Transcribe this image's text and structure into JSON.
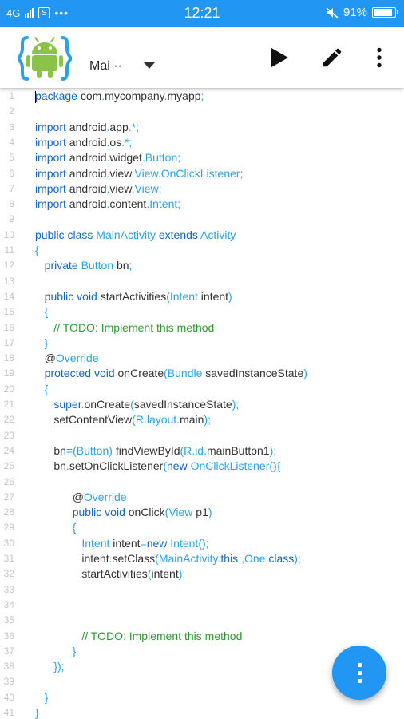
{
  "status_bar": {
    "network": "4G",
    "s_icon": "S",
    "dots": "•••",
    "time": "12:21",
    "battery": "91%",
    "battery_level": 0.91,
    "icons": [
      "signal-icon",
      "mute-icon",
      "battery-icon"
    ]
  },
  "toolbar": {
    "file_tab": "Mai ··",
    "actions": [
      "run-icon",
      "edit-icon",
      "more-vert-icon"
    ]
  },
  "colors": {
    "accent": "#2196f3",
    "keyword": "#1565c0",
    "type": "#29a3e6",
    "comment": "#2e9b2e",
    "text": "#333333",
    "gutter": "#c4c4c4"
  },
  "editor": {
    "lines": [
      {
        "num": "1",
        "text": "package com.mycompany.myapp;"
      },
      {
        "num": "2",
        "text": ""
      },
      {
        "num": "3",
        "text": "import android.app.*;"
      },
      {
        "num": "4",
        "text": "import android.os.*;"
      },
      {
        "num": "5",
        "text": "import android.widget.Button;"
      },
      {
        "num": "6",
        "text": "import android.view.View.OnClickListener;"
      },
      {
        "num": "7",
        "text": "import android.view.View;"
      },
      {
        "num": "8",
        "text": "import android.content.Intent;"
      },
      {
        "num": "9",
        "text": ""
      },
      {
        "num": "10",
        "text": "public class MainActivity extends Activity"
      },
      {
        "num": "11",
        "text": "{"
      },
      {
        "num": "12",
        "text": "   private Button bn;"
      },
      {
        "num": "13",
        "text": ""
      },
      {
        "num": "14",
        "text": "   public void startActivities(Intent intent)"
      },
      {
        "num": "15",
        "text": "   {"
      },
      {
        "num": "16",
        "text": "      // TODO: Implement this method"
      },
      {
        "num": "17",
        "text": "   }"
      },
      {
        "num": "18",
        "text": "   @Override"
      },
      {
        "num": "19",
        "text": "   protected void onCreate(Bundle savedInstanceState)"
      },
      {
        "num": "20",
        "text": "   {"
      },
      {
        "num": "21",
        "text": "      super.onCreate(savedInstanceState);"
      },
      {
        "num": "22",
        "text": "      setContentView(R.layout.main);"
      },
      {
        "num": "23",
        "text": ""
      },
      {
        "num": "24",
        "text": "      bn=(Button) findViewById(R.id.mainButton1);"
      },
      {
        "num": "25",
        "text": "      bn.setOnClickListener(new OnClickListener(){"
      },
      {
        "num": "26",
        "text": ""
      },
      {
        "num": "27",
        "text": "            @Override"
      },
      {
        "num": "28",
        "text": "            public void onClick(View p1)"
      },
      {
        "num": "29",
        "text": "            {"
      },
      {
        "num": "30",
        "text": "               Intent intent=new Intent();"
      },
      {
        "num": "31",
        "text": "               intent.setClass(MainActivity.this ,One.class);"
      },
      {
        "num": "32",
        "text": "               startActivities(intent);"
      },
      {
        "num": "33",
        "text": ""
      },
      {
        "num": "34",
        "text": ""
      },
      {
        "num": "35",
        "text": ""
      },
      {
        "num": "36",
        "text": "               // TODO: Implement this method"
      },
      {
        "num": "37",
        "text": "            }"
      },
      {
        "num": "38",
        "text": "      });"
      },
      {
        "num": "39",
        "text": ""
      },
      {
        "num": "40",
        "text": "   }"
      },
      {
        "num": "41",
        "text": "}"
      }
    ]
  },
  "fab": {
    "icon": "more-vert-icon"
  }
}
